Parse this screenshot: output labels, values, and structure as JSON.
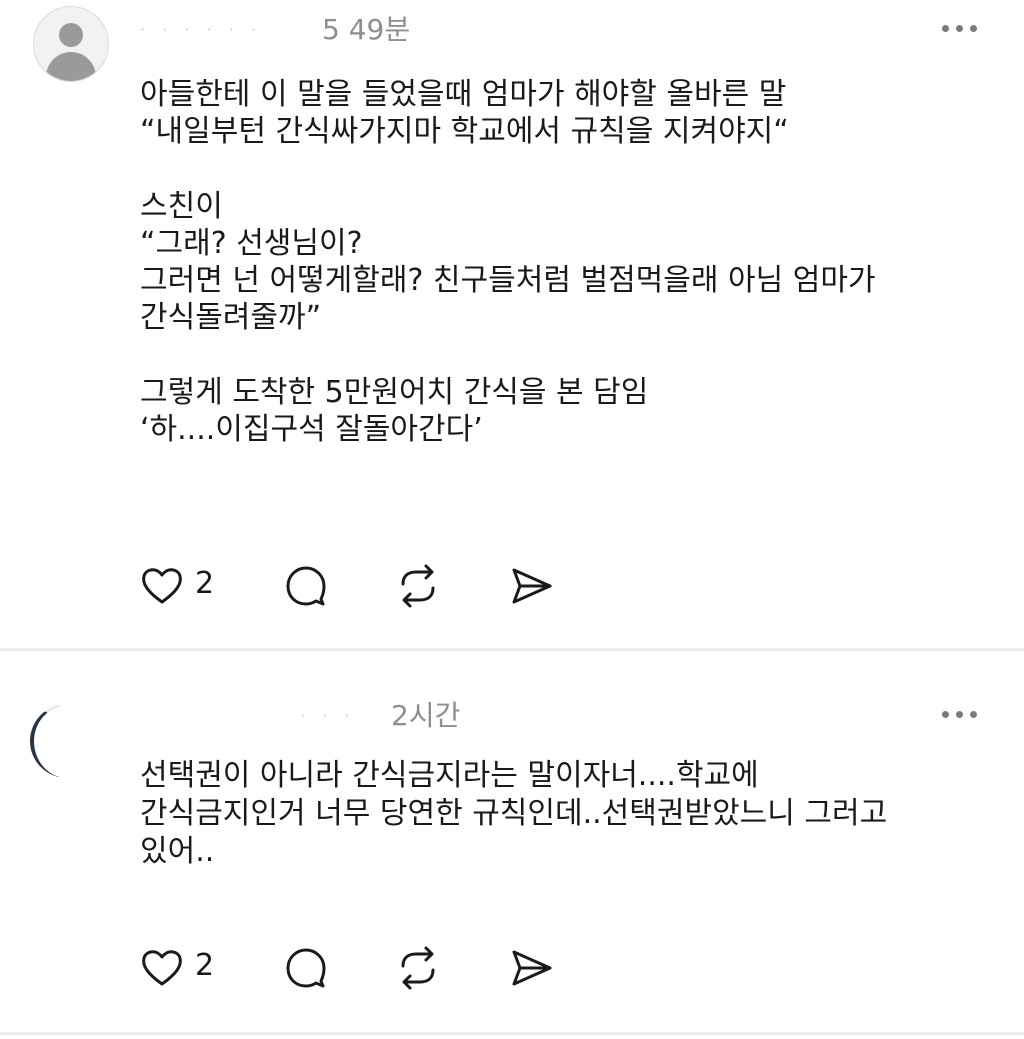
{
  "comments": [
    {
      "username": "· · · · · ·",
      "time": "5 49분",
      "paragraphs": [
        "아들한테 이 말을 들었을때 엄마가 해야할 올바른 말\n“내일부턴 간식싸가지마 학교에서 규칙을 지켜야지“",
        "스친이\n“그래? 선생님이?\n그러면 넌 어떻게할래? 친구들처럼 벌점먹을래 아님 엄마가\n간식돌려줄까”",
        "그렇게 도착한 5만원어치 간식을 본 담임\n‘하....이집구석 잘돌아간다’"
      ],
      "like_count": "2"
    },
    {
      "username": "· · ·",
      "time": "2시간",
      "paragraphs": [
        "선택권이 아니라 간식금지라는 말이자너....학교에\n간식금지인거 너무 당연한 규칙인데..선택권받았느니 그러고\n있어.."
      ],
      "like_count": "2"
    }
  ],
  "icons": {
    "avatar": "default-user-avatar-icon",
    "more": "more-dots-icon",
    "like": "heart-icon",
    "reply": "comment-bubble-icon",
    "repost": "repost-icon",
    "share": "send-icon"
  },
  "colors": {
    "text": "#1a1a1a",
    "meta": "#8e8e8e",
    "divider": "#ececec",
    "avatar_fill": "#9a9a9a"
  }
}
